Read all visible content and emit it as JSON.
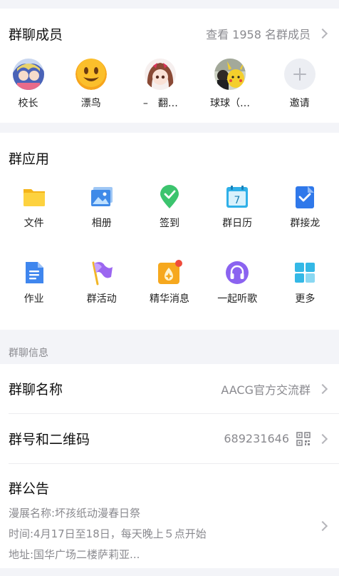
{
  "members": {
    "title": "群聊成员",
    "view_all": "查看 1958 名群成员",
    "list": [
      {
        "name": "校长",
        "icon": "anime-girls-avatar"
      },
      {
        "name": "漂鸟",
        "icon": "smiley-face-avatar"
      },
      {
        "name": "–　翻…",
        "icon": "anime-girl-avatar"
      },
      {
        "name": "球球（…",
        "icon": "pikachu-avatar"
      },
      {
        "name": "邀请",
        "icon": "plus-icon"
      }
    ]
  },
  "apps": {
    "title": "群应用",
    "items": [
      {
        "label": "文件",
        "icon": "folder-icon"
      },
      {
        "label": "相册",
        "icon": "album-icon"
      },
      {
        "label": "签到",
        "icon": "checkin-icon"
      },
      {
        "label": "群日历",
        "icon": "calendar-icon"
      },
      {
        "label": "群接龙",
        "icon": "relay-icon"
      },
      {
        "label": "作业",
        "icon": "homework-icon"
      },
      {
        "label": "群活动",
        "icon": "flag-icon"
      },
      {
        "label": "精华消息",
        "icon": "essence-icon"
      },
      {
        "label": "一起听歌",
        "icon": "headphones-icon"
      },
      {
        "label": "更多",
        "icon": "more-grid-icon"
      }
    ],
    "calendar_day": "7"
  },
  "info": {
    "section_label": "群聊信息",
    "name_label": "群聊名称",
    "name_value": "AACG官方交流群",
    "number_label": "群号和二维码",
    "number_value": "689231646",
    "notice_label": "群公告",
    "notice_lines": [
      "漫展名称:坏孩纸动漫春日祭",
      "时间:4月17日至18日，每天晚上５点开始",
      "地址:国华广场二楼萨莉亚..."
    ]
  }
}
